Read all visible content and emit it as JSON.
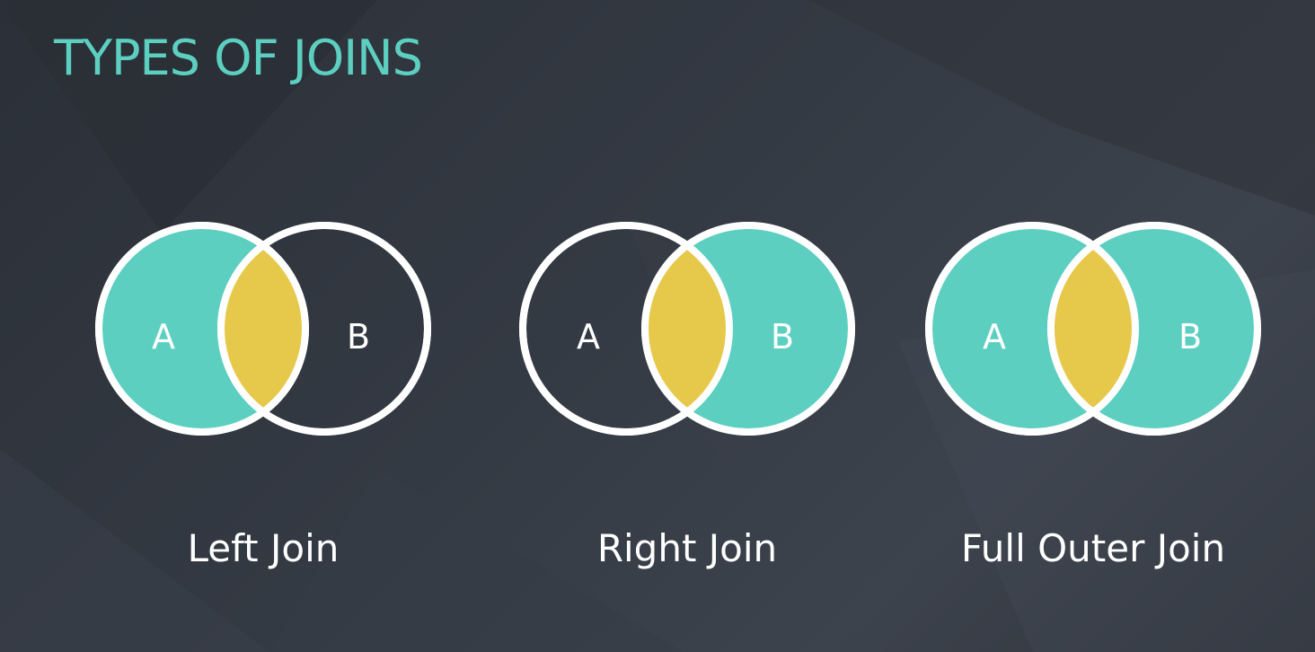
{
  "title": "TYPES OF JOINS",
  "colors": {
    "accent": "#5ccfc1",
    "intersection": "#e6c84a",
    "outline": "#ffffff",
    "background": "#2f343b"
  },
  "diagrams": [
    {
      "label": "Left Join",
      "set_a": "A",
      "set_b": "B",
      "a_filled": true,
      "b_filled": false
    },
    {
      "label": "Right Join",
      "set_a": "A",
      "set_b": "B",
      "a_filled": false,
      "b_filled": true
    },
    {
      "label": "Full Outer Join",
      "set_a": "A",
      "set_b": "B",
      "a_filled": true,
      "b_filled": true
    }
  ]
}
